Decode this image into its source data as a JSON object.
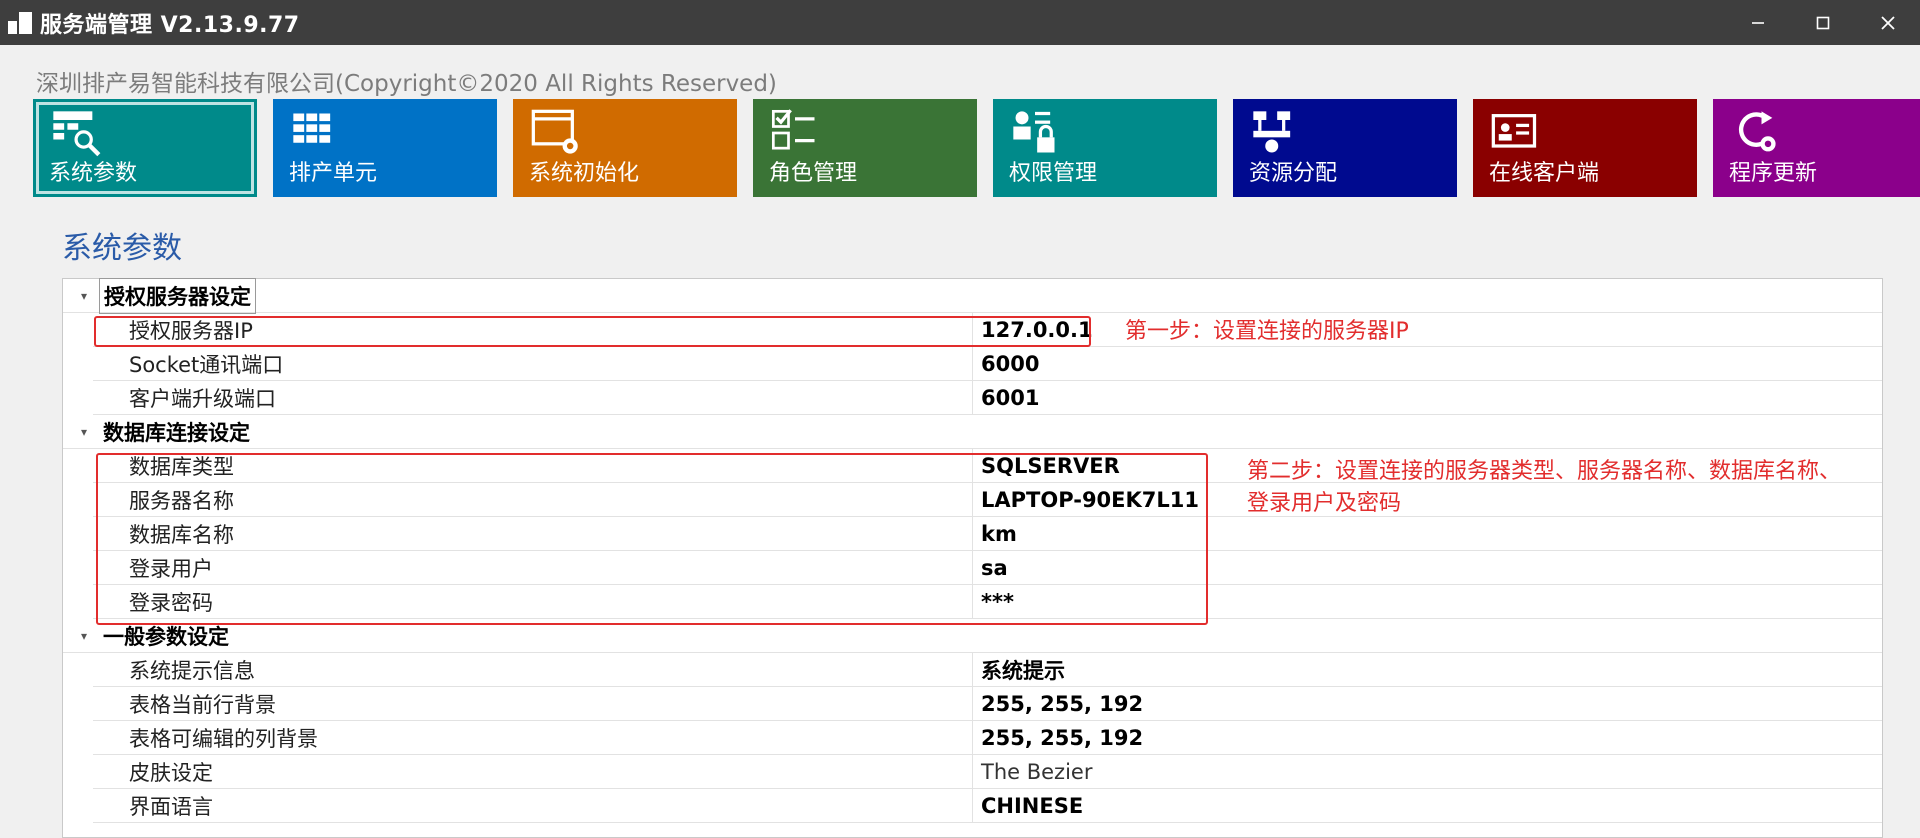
{
  "window": {
    "title": "服务端管理 V2.13.9.77",
    "minimize_icon": "minimize-icon",
    "maximize_icon": "maximize-icon",
    "close_icon": "close-icon"
  },
  "copyright": "深圳排产易智能科技有限公司(Copyright©2020 All Rights Reserved)",
  "tiles": [
    {
      "label": "系统参数",
      "color": "#008a8a",
      "icon": "settings-search-icon",
      "active": true
    },
    {
      "label": "排产单元",
      "color": "#0072c6",
      "icon": "grid-icon",
      "active": false
    },
    {
      "label": "系统初始化",
      "color": "#d06b00",
      "icon": "window-gear-icon",
      "active": false
    },
    {
      "label": "角色管理",
      "color": "#3a7436",
      "icon": "checklist-icon",
      "active": false
    },
    {
      "label": "权限管理",
      "color": "#008a8a",
      "icon": "user-lock-icon",
      "active": false
    },
    {
      "label": "资源分配",
      "color": "#000a8f",
      "icon": "resource-icon",
      "active": false
    },
    {
      "label": "在线客户端",
      "color": "#8a0000",
      "icon": "id-card-icon",
      "active": false
    },
    {
      "label": "程序更新",
      "color": "#8b008b",
      "icon": "refresh-gear-icon",
      "active": false
    }
  ],
  "page_title": "系统参数",
  "sections": [
    {
      "title": "授权服务器设定",
      "rows": [
        {
          "name": "授权服务器IP",
          "value": "127.0.0.1",
          "bold": true
        },
        {
          "name": "Socket通讯端口",
          "value": "6000",
          "bold": true
        },
        {
          "name": "客户端升级端口",
          "value": "6001",
          "bold": true
        }
      ]
    },
    {
      "title": "数据库连接设定",
      "rows": [
        {
          "name": "数据库类型",
          "value": "SQLSERVER",
          "bold": true
        },
        {
          "name": "服务器名称",
          "value": "LAPTOP-90EK7L11",
          "bold": true
        },
        {
          "name": "数据库名称",
          "value": "km",
          "bold": true
        },
        {
          "name": "登录用户",
          "value": "sa",
          "bold": true
        },
        {
          "name": "登录密码",
          "value": "***",
          "bold": true
        }
      ]
    },
    {
      "title": "一般参数设定",
      "rows": [
        {
          "name": "系统提示信息",
          "value": "系统提示",
          "bold": true
        },
        {
          "name": "表格当前行背景",
          "value": "255, 255, 192",
          "bold": true
        },
        {
          "name": "表格可编辑的列背景",
          "value": "255, 255, 192",
          "bold": true
        },
        {
          "name": "皮肤设定",
          "value": "The Bezier",
          "bold": false
        },
        {
          "name": "界面语言",
          "value": "CHINESE",
          "bold": true
        }
      ]
    }
  ],
  "annotations": {
    "step1": "第一步：设置连接的服务器IP",
    "step2_line1": "第二步：设置连接的服务器类型、服务器名称、数据库名称、",
    "step2_line2": "登录用户及密码",
    "color": "#e22d2d"
  }
}
